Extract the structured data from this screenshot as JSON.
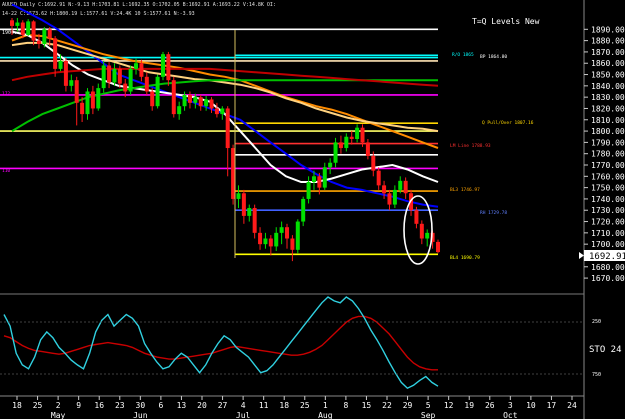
{
  "header": {
    "symbol_line": "AUUSD Daily C:1692.91 N:-9.13 H:1703.81 L:1692.35 O:1702.05 B:1692.91 A:1693.22 V:14.8K OI:",
    "indicator_line": "14-22 C:1573.62 H:1800.19 L:1577.61 V:24.4K 10 S:1577.61 N:-3.93",
    "left_tag": "1900.73",
    "title": "T=Q Levels New"
  },
  "price_axis": {
    "ticks": [
      "1890.00",
      "1880.00",
      "1870.00",
      "1860.00",
      "1850.00",
      "1840.00",
      "1830.00",
      "1820.00",
      "1810.00",
      "1800.00",
      "1790.00",
      "1780.00",
      "1770.00",
      "1760.00",
      "1750.00",
      "1740.00",
      "1730.00",
      "1720.00",
      "1710.00",
      "1700.00",
      "1690.00",
      "1680.00",
      "1670.00"
    ],
    "last_price": "1692.91"
  },
  "stoch_axis": {
    "label": "STO 24",
    "tick_top": "250",
    "tick_bottom": "750"
  },
  "date_axis": {
    "days": [
      "18",
      "25",
      "2",
      "9",
      "16",
      "23",
      "30",
      "6",
      "13",
      "20",
      "27",
      "4",
      "11",
      "18",
      "25",
      "1",
      "8",
      "15",
      "22",
      "29",
      "5",
      "12",
      "19",
      "26",
      "3",
      "10",
      "17",
      "24"
    ],
    "months": [
      "May",
      "Jun",
      "Jul",
      "Aug",
      "Sep",
      "Oct"
    ]
  },
  "levels": {
    "r2_label": "R/O 1865",
    "bp_label": "BP 1864.80",
    "qpullover_label": "Q Pull/Over 1807.16",
    "lm_label": "LM Line 1788.93",
    "bl3_label": "BL3 1746.97",
    "rh_label": "RH 1729.78",
    "bl4_label": "BL4 1690.79",
    "left_labels": [
      "172",
      "110"
    ]
  },
  "chart_data": {
    "type": "candlestick",
    "title": "T=Q Levels New",
    "instrument": "AUUSD Daily",
    "ylim": [
      1663,
      1900
    ],
    "y_ticks": [
      1890,
      1880,
      1870,
      1860,
      1850,
      1840,
      1830,
      1820,
      1810,
      1800,
      1790,
      1780,
      1770,
      1760,
      1750,
      1740,
      1730,
      1720,
      1710,
      1700,
      1690,
      1680,
      1670
    ],
    "last_close": 1692.91,
    "candles": [
      [
        1898,
        1893,
        1900,
        1885
      ],
      [
        1893,
        1896,
        1900,
        1888
      ],
      [
        1896,
        1885,
        1898,
        1882
      ],
      [
        1885,
        1897,
        1899,
        1884
      ],
      [
        1897,
        1880,
        1898,
        1876
      ],
      [
        1880,
        1877,
        1886,
        1873
      ],
      [
        1877,
        1890,
        1892,
        1874
      ],
      [
        1890,
        1882,
        1892,
        1875
      ],
      [
        1882,
        1855,
        1884,
        1848
      ],
      [
        1855,
        1862,
        1868,
        1853
      ],
      [
        1862,
        1840,
        1865,
        1835
      ],
      [
        1840,
        1845,
        1850,
        1835
      ],
      [
        1845,
        1825,
        1848,
        1805
      ],
      [
        1825,
        1815,
        1830,
        1808
      ],
      [
        1815,
        1835,
        1838,
        1810
      ],
      [
        1835,
        1820,
        1840,
        1815
      ],
      [
        1820,
        1838,
        1842,
        1818
      ],
      [
        1838,
        1858,
        1862,
        1834
      ],
      [
        1858,
        1843,
        1861,
        1838
      ],
      [
        1843,
        1855,
        1860,
        1840
      ],
      [
        1855,
        1842,
        1858,
        1838
      ],
      [
        1842,
        1835,
        1846,
        1830
      ],
      [
        1835,
        1855,
        1858,
        1832
      ],
      [
        1855,
        1860,
        1864,
        1850
      ],
      [
        1860,
        1848,
        1863,
        1844
      ],
      [
        1848,
        1835,
        1852,
        1832
      ],
      [
        1835,
        1822,
        1838,
        1818
      ],
      [
        1822,
        1848,
        1850,
        1820
      ],
      [
        1848,
        1868,
        1870,
        1845
      ],
      [
        1868,
        1845,
        1870,
        1840
      ],
      [
        1845,
        1815,
        1848,
        1812
      ],
      [
        1815,
        1822,
        1826,
        1810
      ],
      [
        1822,
        1832,
        1835,
        1818
      ],
      [
        1832,
        1825,
        1835,
        1820
      ],
      [
        1825,
        1830,
        1833,
        1820
      ],
      [
        1830,
        1822,
        1832,
        1818
      ],
      [
        1822,
        1828,
        1831,
        1818
      ],
      [
        1828,
        1820,
        1830,
        1816
      ],
      [
        1820,
        1815,
        1825,
        1812
      ],
      [
        1815,
        1820,
        1822,
        1810
      ],
      [
        1820,
        1785,
        1822,
        1760
      ],
      [
        1785,
        1740,
        1788,
        1735
      ],
      [
        1740,
        1745,
        1752,
        1732
      ],
      [
        1745,
        1725,
        1748,
        1718
      ],
      [
        1725,
        1732,
        1735,
        1720
      ],
      [
        1732,
        1710,
        1735,
        1705
      ],
      [
        1710,
        1700,
        1715,
        1695
      ],
      [
        1700,
        1705,
        1710,
        1696
      ],
      [
        1705,
        1698,
        1708,
        1690
      ],
      [
        1698,
        1710,
        1715,
        1694
      ],
      [
        1710,
        1715,
        1720,
        1700
      ],
      [
        1715,
        1705,
        1718,
        1696
      ],
      [
        1705,
        1695,
        1708,
        1685
      ],
      [
        1695,
        1720,
        1722,
        1692
      ],
      [
        1720,
        1740,
        1742,
        1716
      ],
      [
        1740,
        1755,
        1760,
        1736
      ],
      [
        1755,
        1760,
        1765,
        1748
      ],
      [
        1760,
        1750,
        1763,
        1744
      ],
      [
        1750,
        1768,
        1772,
        1748
      ],
      [
        1768,
        1772,
        1776,
        1762
      ],
      [
        1772,
        1790,
        1794,
        1768
      ],
      [
        1790,
        1785,
        1796,
        1780
      ],
      [
        1785,
        1795,
        1798,
        1782
      ],
      [
        1795,
        1793,
        1800,
        1788
      ],
      [
        1793,
        1803,
        1806,
        1790
      ],
      [
        1803,
        1790,
        1806,
        1786
      ],
      [
        1790,
        1778,
        1793,
        1775
      ],
      [
        1778,
        1765,
        1782,
        1760
      ],
      [
        1765,
        1752,
        1768,
        1748
      ],
      [
        1752,
        1745,
        1756,
        1740
      ],
      [
        1745,
        1735,
        1748,
        1730
      ],
      [
        1735,
        1748,
        1752,
        1732
      ],
      [
        1748,
        1756,
        1760,
        1745
      ],
      [
        1756,
        1745,
        1759,
        1740
      ],
      [
        1745,
        1730,
        1748,
        1725
      ],
      [
        1730,
        1718,
        1733,
        1714
      ],
      [
        1718,
        1705,
        1721,
        1700
      ],
      [
        1705,
        1710,
        1713,
        1698
      ],
      [
        1710,
        1702,
        1712,
        1696
      ],
      [
        1702,
        1693,
        1704,
        1692
      ]
    ],
    "moving_averages": [
      {
        "color": "#0000ff",
        "values": [
          1912,
          1905,
          1898,
          1890,
          1880,
          1870,
          1860,
          1850,
          1845,
          1840,
          1835,
          1830,
          1825,
          1820,
          1815,
          1810,
          1800,
          1790,
          1780,
          1770,
          1762,
          1755,
          1750,
          1748,
          1745,
          1742,
          1738,
          1735,
          1733
        ]
      },
      {
        "color": "#ff8c00",
        "values": [
          1880,
          1885,
          1884,
          1880,
          1876,
          1872,
          1868,
          1865,
          1862,
          1860,
          1858,
          1856,
          1853,
          1850,
          1848,
          1845,
          1840,
          1835,
          1830,
          1826,
          1822,
          1819,
          1815,
          1810,
          1805,
          1800,
          1795,
          1790,
          1785
        ]
      },
      {
        "color": "#ffffff",
        "values": [
          1888,
          1885,
          1878,
          1868,
          1858,
          1850,
          1845,
          1840,
          1838,
          1836,
          1834,
          1832,
          1830,
          1826,
          1815,
          1800,
          1785,
          1770,
          1760,
          1755,
          1755,
          1758,
          1762,
          1766,
          1768,
          1770,
          1766,
          1760,
          1755
        ]
      },
      {
        "color": "#ffd27f",
        "values": [
          1876,
          1878,
          1878,
          1876,
          1872,
          1868,
          1864,
          1860,
          1856,
          1852,
          1850,
          1848,
          1846,
          1845,
          1843,
          1841,
          1838,
          1834,
          1829,
          1825,
          1820,
          1816,
          1812,
          1809,
          1807,
          1805,
          1803,
          1802,
          1800
        ]
      },
      {
        "color": "#00c000",
        "values": [
          1800,
          1808,
          1815,
          1820,
          1825,
          1830,
          1833,
          1836,
          1838,
          1840,
          1842,
          1843,
          1844,
          1845,
          1845,
          1845,
          1845,
          1845,
          1845,
          1845,
          1845,
          1845,
          1845,
          1845,
          1845,
          1845,
          1845,
          1845,
          1845
        ]
      },
      {
        "color": "#c00000",
        "values": [
          1845,
          1848,
          1850,
          1852,
          1853,
          1854,
          1855,
          1855,
          1855,
          1855,
          1855,
          1855,
          1855,
          1855,
          1854,
          1853,
          1852,
          1851,
          1850,
          1849,
          1848,
          1847,
          1846,
          1845,
          1844,
          1843,
          1842,
          1841,
          1840
        ]
      }
    ],
    "horizontal_levels": [
      {
        "value": 1890,
        "color": "#ffffff"
      },
      {
        "value": 1867,
        "color": "#00ffff"
      },
      {
        "value": 1865,
        "color": "#00ffff"
      },
      {
        "value": 1862,
        "color": "#ffe4b5"
      },
      {
        "value": 1832,
        "color": "#ff00ff"
      },
      {
        "value": 1807,
        "color": "#ffd700"
      },
      {
        "value": 1800,
        "color": "#ffff66"
      },
      {
        "value": 1789,
        "color": "#ff3030"
      },
      {
        "value": 1779,
        "color": "#ffffff"
      },
      {
        "value": 1767,
        "color": "#ff00ff"
      },
      {
        "value": 1747,
        "color": "#ffa500"
      },
      {
        "value": 1730,
        "color": "#4060ff"
      },
      {
        "value": 1691,
        "color": "#ffff00"
      }
    ],
    "stochastic": {
      "ylim": [
        0,
        1000
      ],
      "fast": [
        820,
        700,
        420,
        300,
        260,
        380,
        560,
        640,
        580,
        480,
        420,
        350,
        300,
        260,
        420,
        640,
        760,
        820,
        700,
        760,
        820,
        780,
        700,
        520,
        420,
        330,
        260,
        280,
        360,
        420,
        380,
        300,
        220,
        300,
        420,
        520,
        600,
        560,
        480,
        430,
        380,
        300,
        220,
        240,
        300,
        380,
        460,
        540,
        620,
        700,
        780,
        860,
        940,
        1000,
        960,
        940,
        1000,
        960,
        880,
        780,
        660,
        560,
        450,
        330,
        220,
        120,
        60,
        90,
        140,
        180,
        120,
        80
      ],
      "slow": [
        600,
        580,
        540,
        500,
        470,
        450,
        440,
        430,
        420,
        410,
        420,
        440,
        460,
        480,
        500,
        510,
        520,
        530,
        520,
        510,
        500,
        480,
        450,
        420,
        400,
        380,
        370,
        360,
        360,
        370,
        380,
        390,
        400,
        410,
        420,
        440,
        460,
        480,
        490,
        480,
        470,
        460,
        450,
        440,
        430,
        420,
        410,
        400,
        400,
        410,
        430,
        460,
        500,
        560,
        620,
        680,
        740,
        780,
        800,
        800,
        780,
        740,
        680,
        620,
        540,
        460,
        380,
        320,
        280,
        260,
        250,
        250
      ]
    }
  }
}
